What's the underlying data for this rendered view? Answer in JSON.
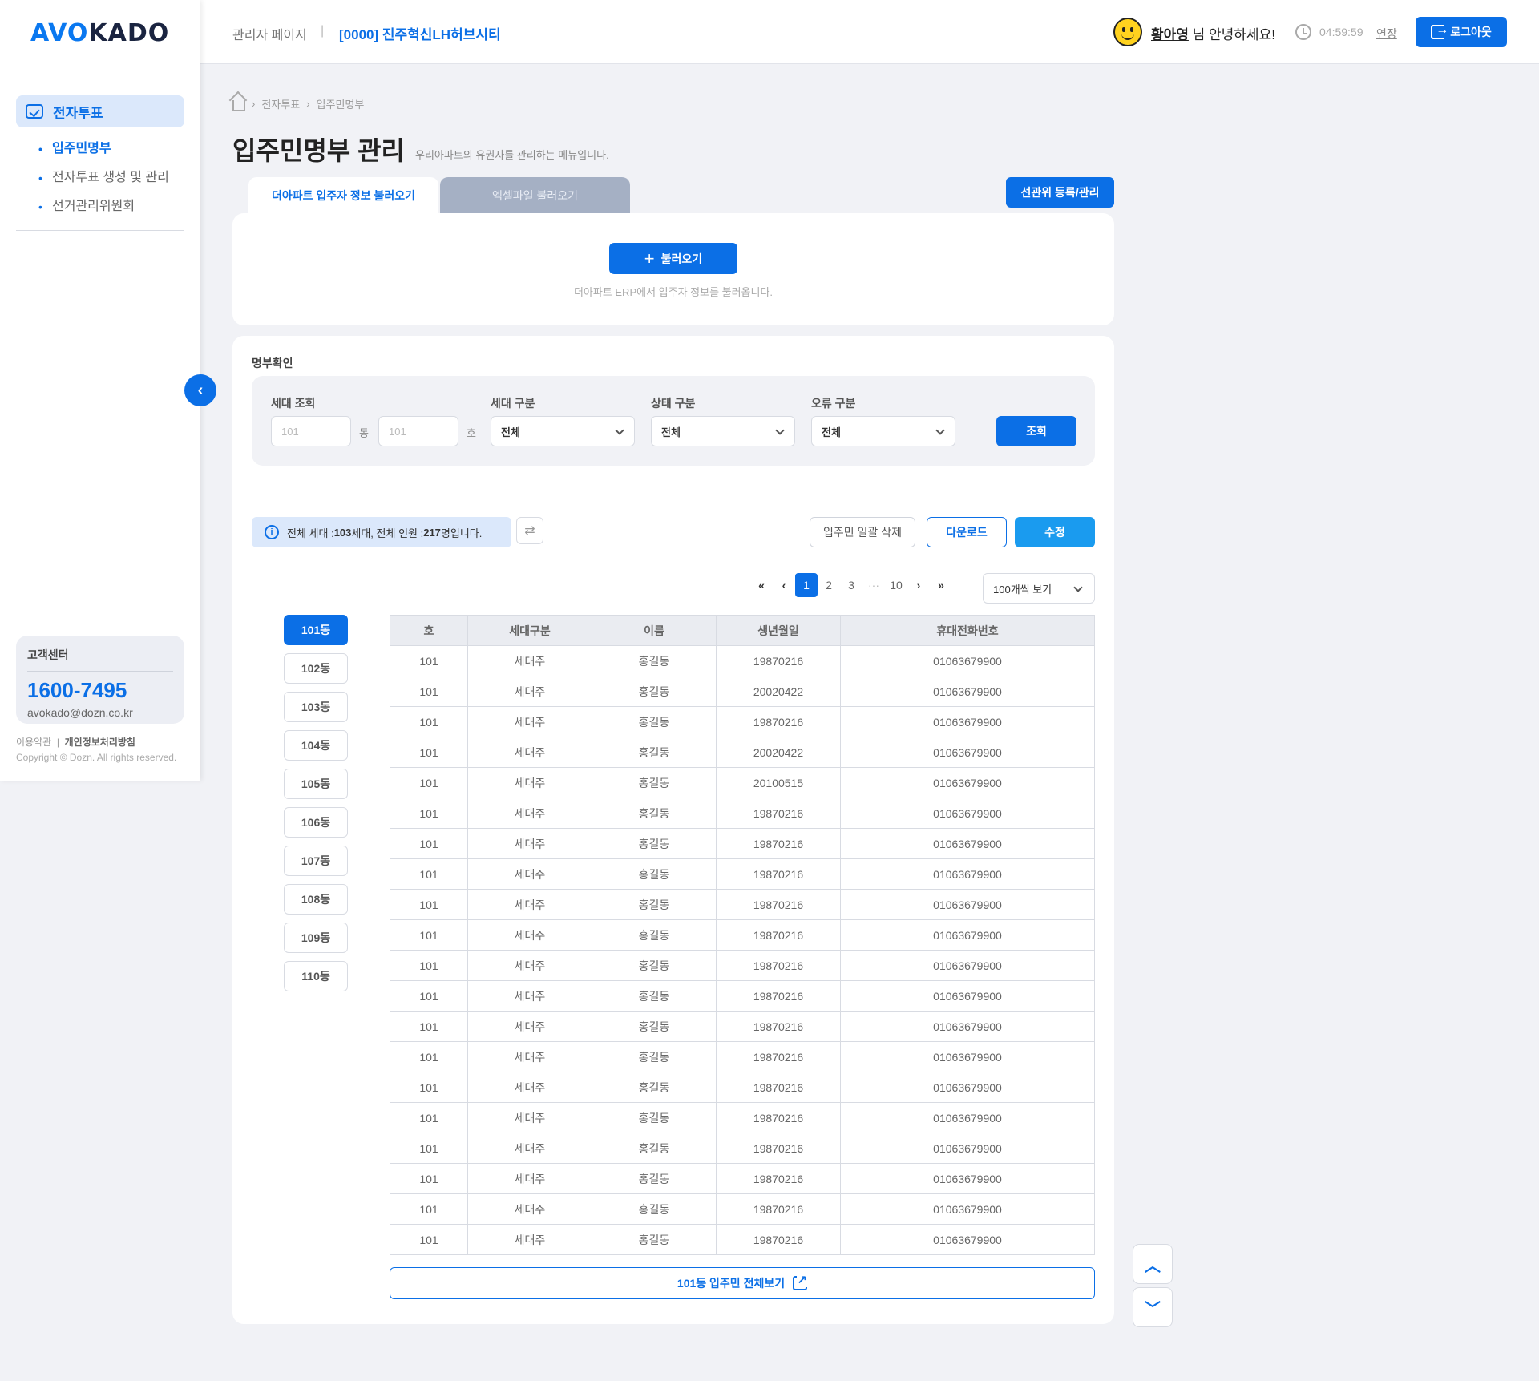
{
  "logo": {
    "text": "AVOKADO"
  },
  "sidebar": {
    "main_label": "전자투표",
    "items": [
      {
        "label": "입주민명부",
        "active": true
      },
      {
        "label": "전자투표 생성 및 관리",
        "active": false
      },
      {
        "label": "선거관리위원회",
        "active": false
      }
    ],
    "cs_title": "고객센터",
    "cs_phone": "1600-7495",
    "cs_email": "avokado@dozn.co.kr",
    "terms": "이용약관",
    "privacy": "개인정보처리방침",
    "copyright": "Copyright © Dozn. All rights reserved."
  },
  "header": {
    "admin_label": "관리자 페이지",
    "separator": "|",
    "site": "[0000] 진주혁신LH허브시티",
    "user_name": "황아영",
    "greeting": " 님 안녕하세요!",
    "time": "04:59:59",
    "extend": "연장",
    "logout": "로그아웃"
  },
  "breadcrumb": [
    "전자투표",
    "입주민명부"
  ],
  "page": {
    "title": "입주민명부 관리",
    "desc": "우리아파트의 유권자를 관리하는 메뉴입니다."
  },
  "tabs": [
    {
      "label": "더아파트 입주자 정보 불러오기",
      "active": true
    },
    {
      "label": "엑셀파일 불러오기",
      "active": false
    }
  ],
  "election_btn": "선관위 등록/관리",
  "import": {
    "button": "불러오기",
    "note": "더아파트 ERP에서 입주자 정보를 불러옵니다."
  },
  "list": {
    "title": "명부확인",
    "filters": {
      "household_label": "세대 조회",
      "dong_placeholder": "101",
      "dong_unit": "동",
      "ho_placeholder": "101",
      "ho_unit": "호",
      "type_label": "세대 구분",
      "type_value": "전체",
      "status_label": "상태 구분",
      "status_value": "전체",
      "error_label": "오류 구분",
      "error_value": "전체",
      "search": "조회"
    },
    "summary": {
      "prefix": "전체 세대 : ",
      "households": "103",
      "mid": "세대, 전체 인원 : ",
      "people": "217",
      "suffix": "명입니다."
    },
    "bulk_delete": "입주민 일괄 삭제",
    "download": "다운로드",
    "edit": "수정",
    "pager": {
      "pages": [
        "1",
        "2",
        "3",
        "···",
        "10"
      ],
      "current": "1"
    },
    "per_page": "100개씩 보기",
    "dongs": [
      "101동",
      "102동",
      "103동",
      "104동",
      "105동",
      "106동",
      "107동",
      "108동",
      "109동",
      "110동"
    ],
    "active_dong": "101동",
    "columns": [
      "호",
      "세대구분",
      "이름",
      "생년월일",
      "휴대전화번호"
    ],
    "rows": [
      [
        "101",
        "세대주",
        "홍길동",
        "19870216",
        "01063679900"
      ],
      [
        "101",
        "세대주",
        "홍길동",
        "20020422",
        "01063679900"
      ],
      [
        "101",
        "세대주",
        "홍길동",
        "19870216",
        "01063679900"
      ],
      [
        "101",
        "세대주",
        "홍길동",
        "20020422",
        "01063679900"
      ],
      [
        "101",
        "세대주",
        "홍길동",
        "20100515",
        "01063679900"
      ],
      [
        "101",
        "세대주",
        "홍길동",
        "19870216",
        "01063679900"
      ],
      [
        "101",
        "세대주",
        "홍길동",
        "19870216",
        "01063679900"
      ],
      [
        "101",
        "세대주",
        "홍길동",
        "19870216",
        "01063679900"
      ],
      [
        "101",
        "세대주",
        "홍길동",
        "19870216",
        "01063679900"
      ],
      [
        "101",
        "세대주",
        "홍길동",
        "19870216",
        "01063679900"
      ],
      [
        "101",
        "세대주",
        "홍길동",
        "19870216",
        "01063679900"
      ],
      [
        "101",
        "세대주",
        "홍길동",
        "19870216",
        "01063679900"
      ],
      [
        "101",
        "세대주",
        "홍길동",
        "19870216",
        "01063679900"
      ],
      [
        "101",
        "세대주",
        "홍길동",
        "19870216",
        "01063679900"
      ],
      [
        "101",
        "세대주",
        "홍길동",
        "19870216",
        "01063679900"
      ],
      [
        "101",
        "세대주",
        "홍길동",
        "19870216",
        "01063679900"
      ],
      [
        "101",
        "세대주",
        "홍길동",
        "19870216",
        "01063679900"
      ],
      [
        "101",
        "세대주",
        "홍길동",
        "19870216",
        "01063679900"
      ],
      [
        "101",
        "세대주",
        "홍길동",
        "19870216",
        "01063679900"
      ],
      [
        "101",
        "세대주",
        "홍길동",
        "19870216",
        "01063679900"
      ]
    ],
    "view_all": "101동 입주민 전체보기"
  },
  "colors": {
    "primary": "#0b6fe6",
    "edit": "#1a9bef",
    "tab_inactive": "#a5b0c4",
    "bg": "#f1f2f6"
  }
}
